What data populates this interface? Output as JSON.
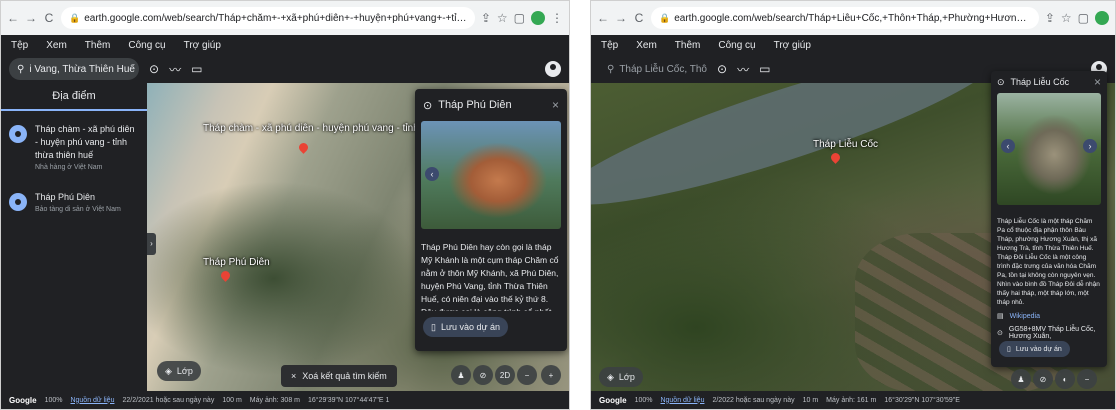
{
  "left": {
    "browser": {
      "url": "earth.google.com/web/search/Tháp+chăm+-+xã+phú+diên+-+huyện+phú+vang+-+tỉnh+thừa+thiên+huế,+Phường+Diên,+Phú+Diên,+Phú+Vang,...",
      "nav_back": "←",
      "nav_forward": "→",
      "nav_reload": "C"
    },
    "menu": [
      "Tệp",
      "Xem",
      "Thêm",
      "Công cụ",
      "Trợ giúp"
    ],
    "search": {
      "value": "i Vang, Thừa Thiên Huế",
      "clear": "×"
    },
    "places_tab": "Địa điểm",
    "places": [
      {
        "name": "Tháp chàm - xã phú diên - huyện phú vang - tỉnh thừa thiên huế",
        "sub": "Nhà hàng ở Việt Nam"
      },
      {
        "name": "Tháp Phú Diên",
        "sub": "Bảo tàng di sản ở Việt Nam"
      }
    ],
    "map_labels": {
      "top": "Tháp chàm - xã phú diên - huyện phú vang - tỉnh thừa thiên...",
      "site": "Tháp Phú Diên"
    },
    "card": {
      "title": "Tháp Phú Diên",
      "close": "×",
      "prev": "‹",
      "description": "Tháp Phú Diên hay còn gọi là tháp Mỹ Khánh là một cụm tháp Chăm cổ nằm ở thôn Mỹ Khánh, xã Phú Diên, huyện Phú Vang, tỉnh Thừa Thiên Huế, có niên đại vào thế kỷ thứ 8. Đây được coi là công trình cổ nhất trong số tháp Chăm còn lại...",
      "save_label": "Lưu vào dự án"
    },
    "layer_label": "Lớp",
    "clear_label": "Xoá kết quả tìm kiếm",
    "view_3d": "2D",
    "status": {
      "brand": "Google",
      "zoom": "100%",
      "data_link": "Nguồn dữ liệu",
      "date": "22/2/2021 hoặc sau ngày này",
      "scale": "100 m",
      "camera": "Máy ảnh: 308 m",
      "coords": "16°29'39\"N 107°44'47\"E 1"
    }
  },
  "right": {
    "browser": {
      "url": "earth.google.com/web/search/Tháp+Liễu+Cốc,+Thôn+Tháp,+Phường+Hương+Xuân,+Hương+Trà,+Thừa+Thiên+Huế/@16.50806441,107.51642673,4.74349102a,193.3...",
      "nav_back": "←",
      "nav_forward": "→",
      "nav_reload": "C"
    },
    "menu": [
      "Tệp",
      "Xem",
      "Thêm",
      "Công cụ",
      "Trợ giúp"
    ],
    "search": {
      "value": "Tháp Liễu Cốc, Thôn Tháp, Phườn"
    },
    "map_label": "Tháp Liễu Cốc",
    "card": {
      "title": "Tháp Liễu Cốc",
      "close": "×",
      "prev": "‹",
      "next": "›",
      "description": "Tháp Liễu Cốc là một tháp Chăm Pa cổ thuộc địa phận thôn Bàu Tháp, phường Hương Xuân, thị xã Hương Trà, tỉnh Thừa Thiên Huế. Tháp Đôi Liễu Cốc là một công trình đặc trưng của văn hóa Chăm Pa, tồn tại không còn nguyên vẹn. Nhìn vào bình đồ Tháp Đôi dễ nhận thấy hai tháp, một tháp lớn, một tháp nhỏ.",
      "wiki_label": "Wikipedia",
      "address": "GG58+8MV Tháp Liễu Cốc, Hương Xuân,",
      "save_label": "Lưu vào dự án"
    },
    "layer_label": "Lớp",
    "status": {
      "brand": "Google",
      "zoom": "100%",
      "data_link": "Nguồn dữ liệu",
      "date": "2/2022 hoặc sau ngày này",
      "scale": "10 m",
      "camera": "Máy ảnh: 161 m",
      "coords": "16°30'29\"N 107°30'59\"E"
    }
  }
}
